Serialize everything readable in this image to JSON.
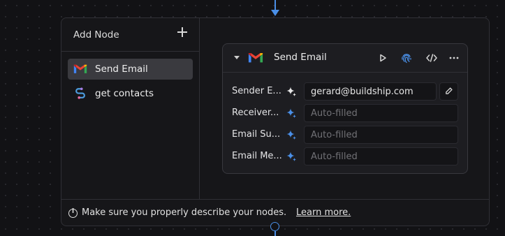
{
  "sidebar": {
    "title": "Add Node",
    "items": [
      {
        "label": "Send Email",
        "icon": "gmail-icon"
      },
      {
        "label": "get contacts",
        "icon": "script-icon"
      }
    ]
  },
  "node": {
    "title": "Send Email",
    "icon": "gmail-icon",
    "actions": [
      "play-icon",
      "fingerprint-icon",
      "code-icon",
      "more-icon"
    ],
    "fields": [
      {
        "label": "Sender E...",
        "value": "gerard@buildship.com",
        "filled": true
      },
      {
        "label": "Receiver...",
        "placeholder": "Auto-filled",
        "filled": false
      },
      {
        "label": "Email Su...",
        "placeholder": "Auto-filled",
        "filled": false
      },
      {
        "label": "Email Me...",
        "placeholder": "Auto-filled",
        "filled": false
      }
    ]
  },
  "footer": {
    "text": "Make sure you properly describe your nodes.",
    "link": "Learn more."
  },
  "colors": {
    "accent": "#4a8fe7",
    "background": "#121215",
    "panel": "#161619"
  }
}
